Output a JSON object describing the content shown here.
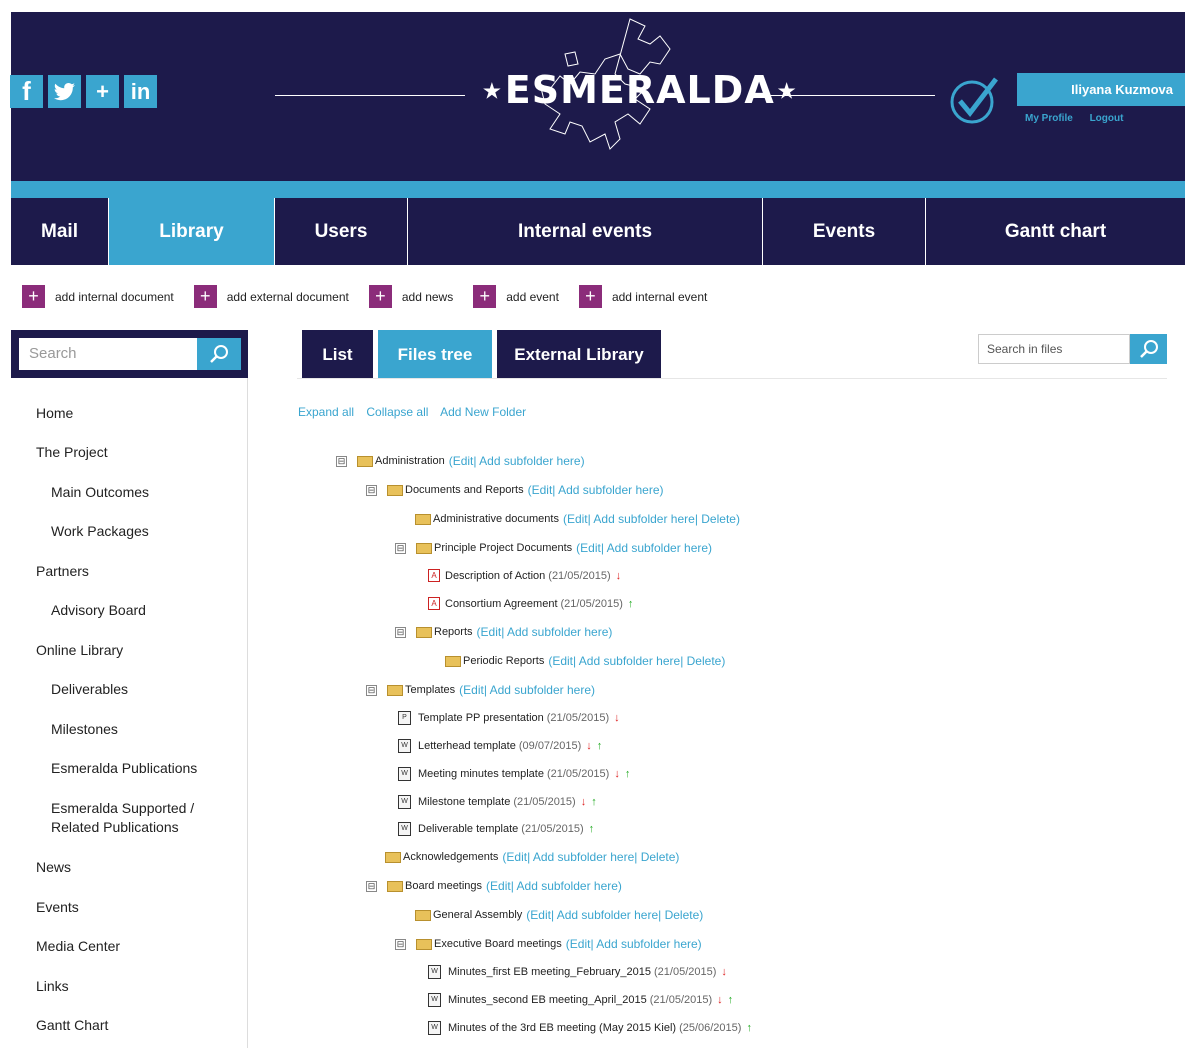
{
  "header": {
    "logo_text": "⋆ESMERALDA⋆",
    "social": [
      "f",
      "✓",
      "+",
      "in"
    ],
    "user_name": "Iliyana Kuzmova",
    "my_profile": "My Profile",
    "logout": "Logout"
  },
  "nav": [
    "Mail",
    "Library",
    "Users",
    "Internal events",
    "Events",
    "Gantt chart"
  ],
  "actions": [
    "add internal document",
    "add external document",
    "add news",
    "add event",
    "add internal event"
  ],
  "sidebar": {
    "search_placeholder": "Search",
    "items": [
      "Home",
      "The Project",
      "Main Outcomes",
      "Work Packages",
      "Partners",
      "Advisory Board",
      "Online Library",
      "Deliverables",
      "Milestones",
      "Esmeralda Publications",
      "Esmeralda Supported /",
      "Related Publications",
      "News",
      "Events",
      "Media Center",
      "Links",
      "Gantt Chart"
    ]
  },
  "tabs": [
    "List",
    "Files tree",
    "External Library"
  ],
  "file_search_placeholder": "Search in files",
  "tree_actions": [
    "Expand all",
    "Collapse all",
    "Add New Folder"
  ],
  "tree": [
    {
      "name": "Administration",
      "ops": "(Edit| Add subfolder here)"
    },
    {
      "name": "Documents and Reports",
      "ops": "(Edit| Add subfolder here)"
    },
    {
      "name": "Administrative documents",
      "ops": "(Edit| Add subfolder here| Delete)"
    },
    {
      "name": "Principle Project Documents",
      "ops": "(Edit| Add subfolder here)"
    },
    {
      "name": "Description of Action",
      "date": "(21/05/2015)"
    },
    {
      "name": "Consortium Agreement",
      "date": "(21/05/2015)"
    },
    {
      "name": "Reports",
      "ops": "(Edit| Add subfolder here)"
    },
    {
      "name": "Periodic Reports",
      "ops": "(Edit| Add subfolder here| Delete)"
    },
    {
      "name": "Templates",
      "ops": "(Edit| Add subfolder here)"
    },
    {
      "name": "Template PP presentation",
      "date": "(21/05/2015)"
    },
    {
      "name": "Letterhead template",
      "date": "(09/07/2015)"
    },
    {
      "name": "Meeting minutes template",
      "date": "(21/05/2015)"
    },
    {
      "name": "Milestone template",
      "date": "(21/05/2015)"
    },
    {
      "name": "Deliverable template",
      "date": "(21/05/2015)"
    },
    {
      "name": "Acknowledgements",
      "ops": "(Edit| Add subfolder here| Delete)"
    },
    {
      "name": "Board meetings",
      "ops": "(Edit| Add subfolder here)"
    },
    {
      "name": "General Assembly",
      "ops": "(Edit| Add subfolder here| Delete)"
    },
    {
      "name": "Executive Board meetings",
      "ops": "(Edit| Add subfolder here)"
    },
    {
      "name": "Minutes_first EB meeting_February_2015",
      "date": "(21/05/2015)"
    },
    {
      "name": "Minutes_second EB meeting_April_2015",
      "date": "(21/05/2015)"
    },
    {
      "name": "Minutes of the 3rd EB meeting (May 2015 Kiel)",
      "date": "(25/06/2015)"
    }
  ],
  "arrows": {
    "down": "↓",
    "up": "↑",
    "expander": "⊟"
  },
  "colors": {
    "navy": "#1d1a4b",
    "accent": "#3aa5cf",
    "plus": "#8b2c7a"
  }
}
